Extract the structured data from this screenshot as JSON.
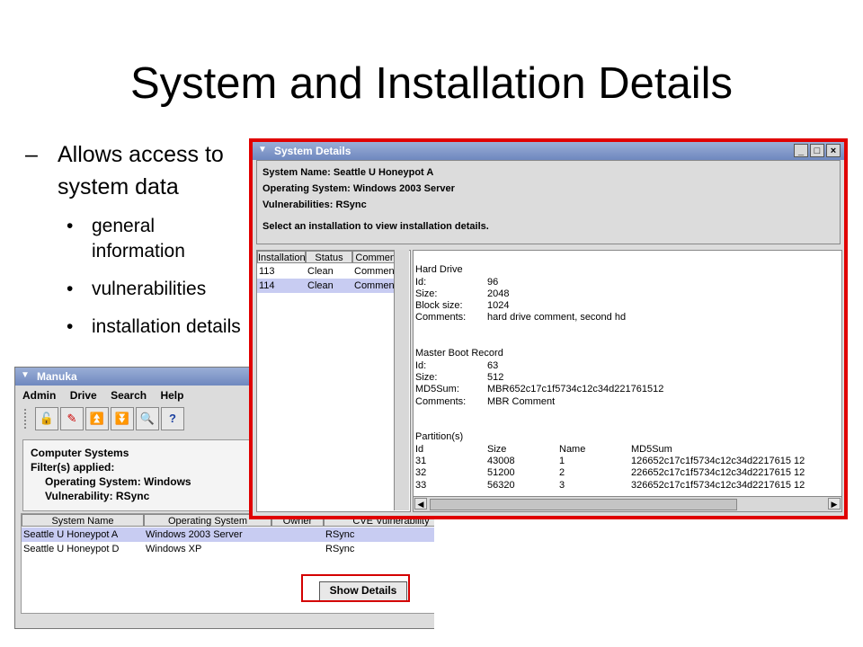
{
  "slide": {
    "title": "System and Installation Details",
    "bullet": "Allows access to system data",
    "sub_bullets": [
      "general information",
      "vulnerabilities",
      "installation details"
    ]
  },
  "manuka": {
    "title": "Manuka",
    "menu": [
      "Admin",
      "Drive",
      "Search",
      "Help"
    ],
    "toolbar_icons": [
      "lock-icon",
      "pen-icon",
      "up-arrow-icon",
      "down-arrow-icon",
      "magnifier-icon",
      "help-icon"
    ],
    "info": {
      "heading": "Computer Systems",
      "filters_label": "Filter(s) applied:",
      "filter1": "Operating System: Windows",
      "filter2": "Vulnerability: RSync"
    },
    "columns": [
      "System Name",
      "Operating System",
      "Owner",
      "CVE Vulnerability"
    ],
    "rows": [
      [
        "Seattle U Honeypot A",
        "Windows 2003 Server",
        "",
        "RSync"
      ],
      [
        "Seattle U Honeypot D",
        "Windows XP",
        "",
        "RSync"
      ]
    ],
    "show_details_label": "Show Details"
  },
  "details": {
    "title": "System Details",
    "system_name": "System Name: Seattle U Honeypot A",
    "os": "Operating System: Windows 2003 Server",
    "vulns": "Vulnerabilities: RSync",
    "prompt": "Select an installation to view installation details.",
    "inst_columns": [
      "Installation",
      "Status",
      "Comments"
    ],
    "inst_rows": [
      [
        "113",
        "Clean",
        "Commen..."
      ],
      [
        "114",
        "Clean",
        "Commen..."
      ]
    ],
    "hard_drive": {
      "heading": "Hard Drive",
      "id_label": "Id:",
      "id": "96",
      "size_label": "Size:",
      "size": "2048",
      "block_label": "Block size:",
      "block": "1024",
      "comments_label": "Comments:",
      "comments": "hard drive comment, second hd"
    },
    "mbr": {
      "heading": "Master Boot Record",
      "id_label": "Id:",
      "id": "63",
      "size_label": "Size:",
      "size": "512",
      "md5_label": "MD5Sum:",
      "md5": "MBR652c17c1f5734c12c34d221761512",
      "comments_label": "Comments:",
      "comments": "MBR Comment"
    },
    "partitions": {
      "heading": "Partition(s)",
      "columns": [
        "Id",
        "Size",
        "Name",
        "MD5Sum"
      ],
      "rows": [
        [
          "31",
          "43008",
          "1",
          "126652c17c1f5734c12c34d2217615 12"
        ],
        [
          "32",
          "51200",
          "2",
          "226652c17c1f5734c12c34d2217615 12"
        ],
        [
          "33",
          "56320",
          "3",
          "326652c17c1f5734c12c34d2217615 12"
        ]
      ]
    }
  }
}
